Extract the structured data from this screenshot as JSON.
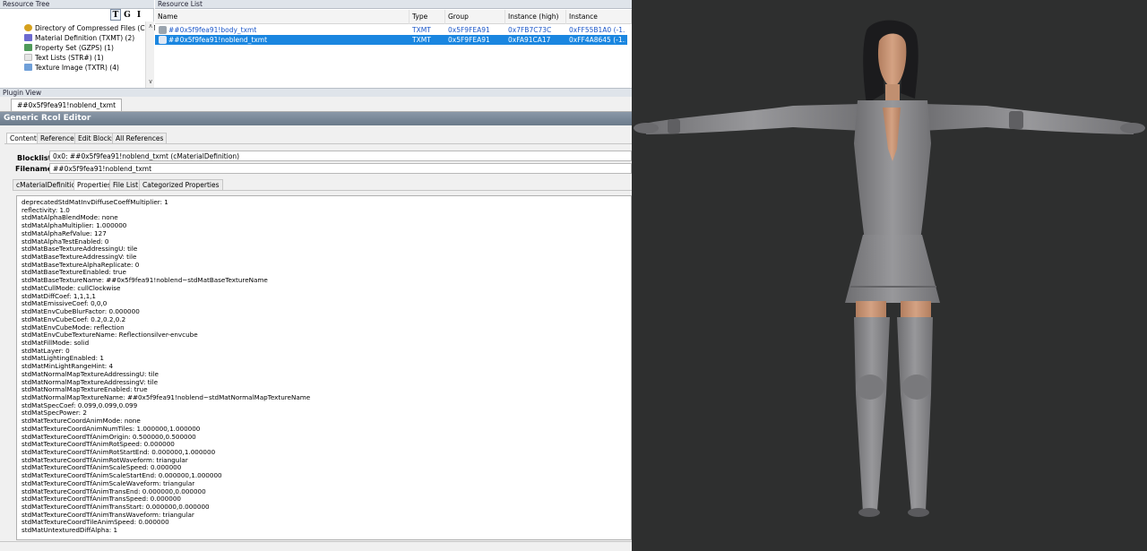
{
  "resource_tree": {
    "title": "Resource Tree",
    "tools": [
      "T",
      "G",
      "I"
    ],
    "items": [
      {
        "label": "Directory of Compressed Files (CLST)",
        "icon": "gold-file-icon",
        "color": "#d6a11e"
      },
      {
        "label": "Material Definition (TXMT) (2)",
        "icon": "material-icon",
        "color": "#6c6ad0"
      },
      {
        "label": "Property Set (GZPS) (1)",
        "icon": "property-set-icon",
        "color": "#4f9a5a"
      },
      {
        "label": "Text Lists (STR#) (1)",
        "icon": "text-list-icon",
        "color": "#c9c9c9"
      },
      {
        "label": "Texture Image (TXTR) (4)",
        "icon": "texture-icon",
        "color": "#6f9fd8"
      }
    ]
  },
  "resource_list": {
    "title": "Resource List",
    "columns": [
      "Name",
      "Type",
      "Group",
      "Instance (high)",
      "Instance"
    ],
    "rows": [
      {
        "name": "##0x5f9fea91!body_txmt",
        "type": "TXMT",
        "group": "0x5F9FEA91",
        "instance_high": "0x7FB7C73C",
        "instance": "0xFF55B1A0 (-1...",
        "selected": false
      },
      {
        "name": "##0x5f9fea91!noblend_txmt",
        "type": "TXMT",
        "group": "0x5F9FEA91",
        "instance_high": "0xFA91CA17",
        "instance": "0xFF4A8645 (-1...",
        "selected": true
      }
    ]
  },
  "plugin_view": {
    "title": "Plugin View",
    "tab_label": "##0x5f9fea91!noblend_txmt"
  },
  "editor": {
    "title": "Generic Rcol Editor",
    "tabs": [
      "Content",
      "Reference",
      "Edit Blocks",
      "All References"
    ],
    "blocklist_label": "Blocklist:",
    "blocklist_value": "0x0: ##0x5f9fea91!noblend_txmt (cMaterialDefinition)",
    "filename_label": "Filename:",
    "filename_value": "##0x5f9fea91!noblend_txmt",
    "subtabs": [
      "cMaterialDefinition",
      "Properties",
      "File List",
      "Categorized Properties"
    ],
    "properties": [
      "deprecatedStdMatInvDiffuseCoeffMultiplier: 1",
      "reflectivity: 1.0",
      "stdMatAlphaBlendMode: none",
      "stdMatAlphaMultiplier: 1.000000",
      "stdMatAlphaRefValue: 127",
      "stdMatAlphaTestEnabled: 0",
      "stdMatBaseTextureAddressingU: tile",
      "stdMatBaseTextureAddressingV: tile",
      "stdMatBaseTextureAlphaReplicate: 0",
      "stdMatBaseTextureEnabled: true",
      "stdMatBaseTextureName: ##0x5f9fea91!noblend~stdMatBaseTextureName",
      "stdMatCullMode: cullClockwise",
      "stdMatDiffCoef: 1,1,1,1",
      "stdMatEmissiveCoef: 0,0,0",
      "stdMatEnvCubeBlurFactor: 0.000000",
      "stdMatEnvCubeCoef: 0.2,0.2,0.2",
      "stdMatEnvCubeMode: reflection",
      "stdMatEnvCubeTextureName: Reflectionsilver-envcube",
      "stdMatFillMode: solid",
      "stdMatLayer: 0",
      "stdMatLightingEnabled: 1",
      "stdMatMinLightRangeHint: 4",
      "stdMatNormalMapTextureAddressingU: tile",
      "stdMatNormalMapTextureAddressingV: tile",
      "stdMatNormalMapTextureEnabled: true",
      "stdMatNormalMapTextureName: ##0x5f9fea91!noblend~stdMatNormalMapTextureName",
      "stdMatSpecCoef: 0.099,0.099,0.099",
      "stdMatSpecPower: 2",
      "stdMatTextureCoordAnimMode: none",
      "stdMatTextureCoordAnimNumTiles: 1.000000,1.000000",
      "stdMatTextureCoordTfAnimOrigin: 0.500000,0.500000",
      "stdMatTextureCoordTfAnimRotSpeed: 0.000000",
      "stdMatTextureCoordTfAnimRotStartEnd: 0.000000,1.000000",
      "stdMatTextureCoordTfAnimRotWaveform: triangular",
      "stdMatTextureCoordTfAnimScaleSpeed: 0.000000",
      "stdMatTextureCoordTfAnimScaleStartEnd: 0.000000,1.000000",
      "stdMatTextureCoordTfAnimScaleWaveform: triangular",
      "stdMatTextureCoordTfAnimTransEnd: 0.000000,0.000000",
      "stdMatTextureCoordTfAnimTransSpeed: 0.000000",
      "stdMatTextureCoordTfAnimTransStart: 0.000000,0.000000",
      "stdMatTextureCoordTfAnimTransWaveform: triangular",
      "stdMatTextureCoordTileAnimSpeed: 0.000000",
      "stdMatUntexturedDiffAlpha: 1"
    ]
  },
  "viewport": {
    "background": "#2e2f2f",
    "model_color": "#8d8d8f",
    "skin_color": "#c99878"
  }
}
